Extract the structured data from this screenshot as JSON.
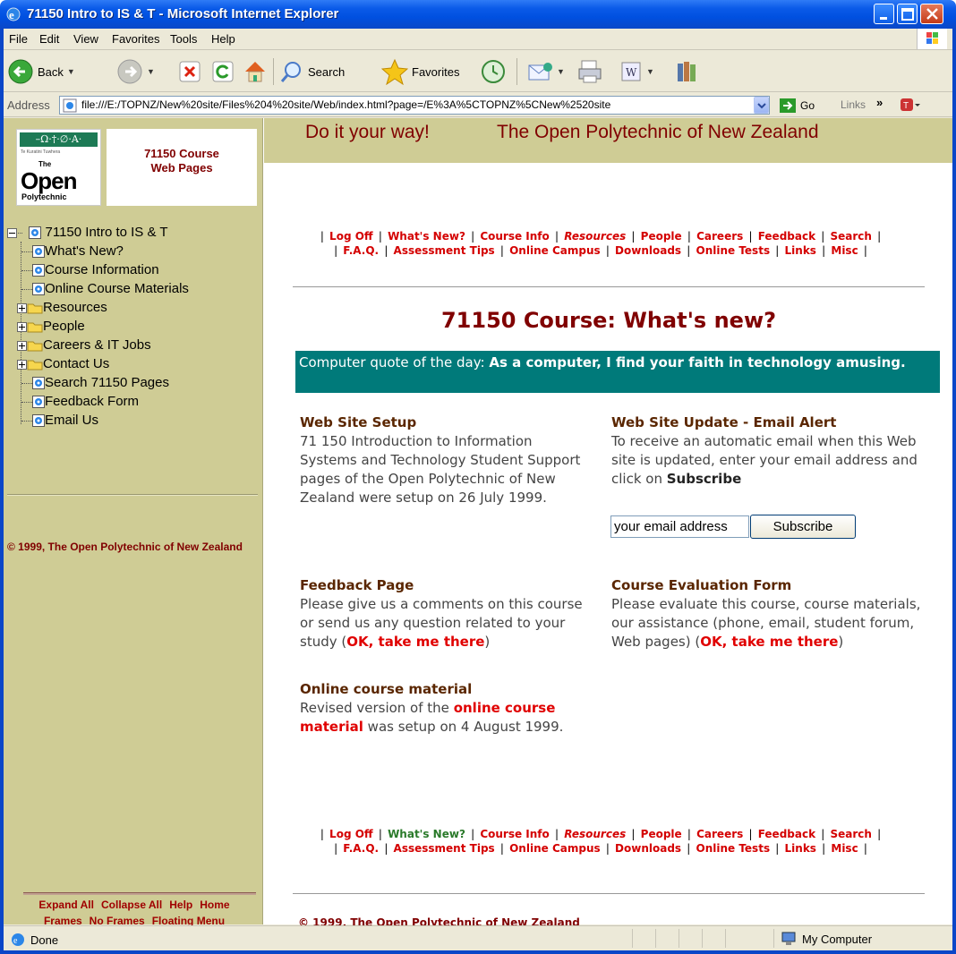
{
  "window": {
    "title": "71150 Intro to IS & T - Microsoft Internet Explorer"
  },
  "menu": [
    "File",
    "Edit",
    "View",
    "Favorites",
    "Tools",
    "Help"
  ],
  "toolbar": {
    "back": "Back",
    "search": "Search",
    "favorites": "Favorites"
  },
  "address": {
    "label": "Address",
    "url": "file:///E:/TOPNZ/New%20site/Files%204%20site/Web/index.html?page=/E%3A%5CTOPNZ%5CNew%2520site",
    "go": "Go",
    "links": "Links"
  },
  "left": {
    "course_title_line1": "71150 Course",
    "course_title_line2": "Web Pages",
    "logo_top": "–Ω·†·∅·A·",
    "logo_small": "Te Kuratini Tuwhera",
    "logo_open": "Open",
    "logo_the": "The",
    "logo_poly": "Polytechnic",
    "tree": [
      {
        "label": "71150 Intro to IS & T",
        "type": "root"
      },
      {
        "label": "What's New?",
        "type": "page"
      },
      {
        "label": "Course Information",
        "type": "page"
      },
      {
        "label": "Online Course Materials",
        "type": "page"
      },
      {
        "label": "Resources",
        "type": "folder"
      },
      {
        "label": "People",
        "type": "folder"
      },
      {
        "label": "Careers & IT Jobs",
        "type": "folder"
      },
      {
        "label": "Contact Us",
        "type": "folder"
      },
      {
        "label": "Search 71150 Pages",
        "type": "page"
      },
      {
        "label": "Feedback Form",
        "type": "page"
      },
      {
        "label": "Email Us",
        "type": "page"
      }
    ],
    "copyright": "© 1999, The Open Polytechnic of New Zealand",
    "bottom_links_row1": [
      "Expand All",
      "Collapse All",
      "Help",
      "Home"
    ],
    "bottom_links_row2": [
      "Frames",
      "No Frames",
      "Floating Menu"
    ]
  },
  "banner": {
    "slogan": "Do it your way!",
    "org": "The Open Polytechnic of New Zealand"
  },
  "nav": {
    "row1": [
      "Log Off",
      "What's New?",
      "Course Info",
      "Resources",
      "People",
      "Careers",
      "Feedback",
      "Search"
    ],
    "row2": [
      "F.A.Q.",
      "Assessment Tips",
      "Online Campus",
      "Downloads",
      "Online Tests",
      "Links",
      "Misc"
    ]
  },
  "main": {
    "title": "71150 Course: What's new?",
    "quote_label": "Computer quote of the day: ",
    "quote_text": "As a computer, I find your faith in technology amusing.",
    "setup_heading": "Web Site Setup",
    "setup_body": "71 150  Introduction to Information Systems and Technology Student Support pages of the Open Polytechnic of New Zealand were setup on 26 July 1999.",
    "alert_heading": "Web Site Update - Email Alert",
    "alert_body": "To receive an automatic email when this Web site is updated, enter your email address and click on ",
    "alert_bold": "Subscribe",
    "email_value": "your email address",
    "subscribe_button": "Subscribe",
    "feedback_heading": "Feedback Page",
    "feedback_body": "Please give us a comments on this course or send us any question related to your study (",
    "feedback_link": "OK, take me there",
    "feedback_end": ")",
    "eval_heading": "Course Evaluation Form",
    "eval_body": "Please evaluate this course, course materials, our assistance (phone, email, student forum, Web pages) (",
    "eval_link": "OK, take me there",
    "eval_end": ")",
    "online_heading": "Online course material",
    "online_body1": "Revised version of the ",
    "online_link": "online course material",
    "online_body2": " was setup on 4 August 1999.",
    "copyright": "© 1999, The Open Polytechnic of New Zealand"
  },
  "status": {
    "left": "Done",
    "zone": "My Computer"
  }
}
